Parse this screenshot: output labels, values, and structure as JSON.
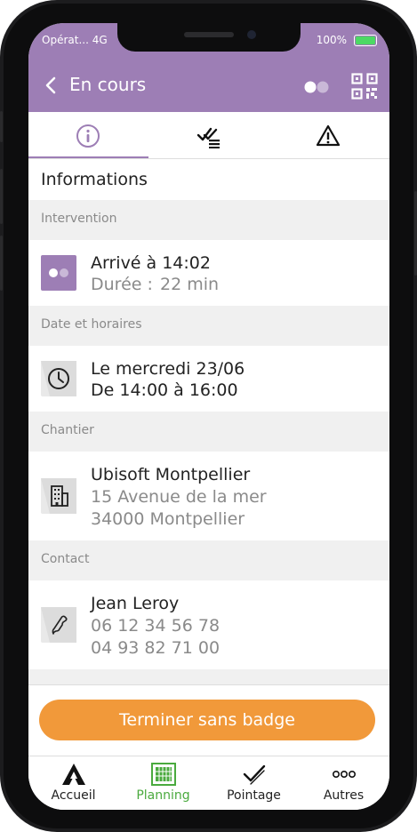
{
  "status_bar": {
    "carrier": "Opérat... 4G",
    "battery": "100%"
  },
  "header": {
    "title": "En cours",
    "back_icon": "chevron-left-icon",
    "toggle_icon": "toggle-icon",
    "qr_icon": "qr-code-icon"
  },
  "tabs": [
    {
      "icon": "info-icon",
      "active": true
    },
    {
      "icon": "checklist-icon",
      "active": false
    },
    {
      "icon": "warning-icon",
      "active": false
    }
  ],
  "page_title": "Informations",
  "sections": {
    "intervention": {
      "label": "Intervention",
      "line1": "Arrivé à 14:02",
      "duration_label": "Durée :",
      "duration_value": "22 min"
    },
    "schedule": {
      "label": "Date et horaires",
      "line1": "Le mercredi 23/06",
      "line2": "De 14:00 à 16:00"
    },
    "site": {
      "label": "Chantier",
      "line1": "Ubisoft Montpellier",
      "line2": "15 Avenue de la mer",
      "line3": "34000 Montpellier"
    },
    "contact": {
      "label": "Contact",
      "line1": "Jean Leroy",
      "line2": "06 12 34 56 78",
      "line3": "04 93 82 71 00"
    }
  },
  "cta": {
    "label": "Terminer sans badge"
  },
  "bottom_nav": [
    {
      "label": "Accueil",
      "icon": "home-mountain-icon",
      "active": false
    },
    {
      "label": "Planning",
      "icon": "calendar-grid-icon",
      "active": true
    },
    {
      "label": "Pointage",
      "icon": "check-icon",
      "active": false
    },
    {
      "label": "Autres",
      "icon": "more-dots-icon",
      "active": false
    }
  ],
  "colors": {
    "accent": "#9d7eb5",
    "cta": "#f1993a",
    "success": "#7ab11c",
    "nav_active": "#4aaa3e"
  }
}
